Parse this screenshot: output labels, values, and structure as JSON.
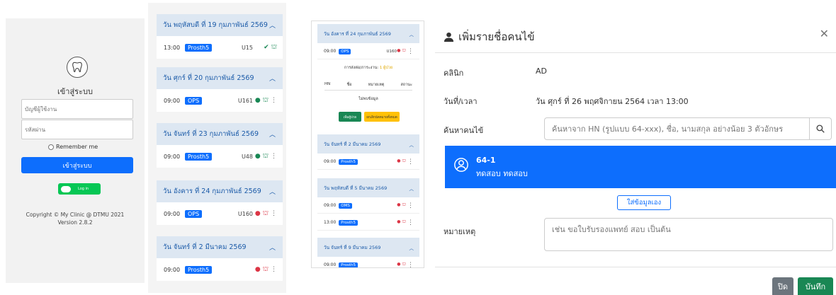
{
  "login": {
    "title": "เข้าสู่ระบบ",
    "username_placeholder": "บัญชีผู้ใช้งาน",
    "password_placeholder": "รหัสผ่าน",
    "remember_label": "Remember me",
    "login_button": "เข้าสู่ระบบ",
    "line_button": "Log in",
    "copyright": "Copyright © My Clinic @ DTMU 2021",
    "version": "Version 2.8.2"
  },
  "appointments": [
    {
      "date": "วัน พฤหัสบดี ที่ 19 กุมภาพันธ์ 2569",
      "time": "13:00",
      "clinic": "Prosth5",
      "room": "U15",
      "status": "done"
    },
    {
      "date": "วัน ศุกร์ ที่ 20 กุมภาพันธ์ 2569",
      "time": "09:00",
      "clinic": "OPS",
      "room": "U161",
      "status": "green"
    },
    {
      "date": "วัน จันทร์ ที่ 23 กุมภาพันธ์ 2569",
      "time": "09:00",
      "clinic": "Prosth5",
      "room": "U48",
      "status": "green"
    },
    {
      "date": "วัน อังคาร ที่ 24 กุมภาพันธ์ 2569",
      "time": "09:00",
      "clinic": "OPS",
      "room": "U160",
      "status": "red"
    },
    {
      "date": "วัน จันทร์ ที่ 2 มีนาคม 2569",
      "time": "09:00",
      "clinic": "Prosth5",
      "room": "",
      "status": "red"
    }
  ],
  "mini": {
    "header1": "วัน อังคาร ที่ 24 กุมภาพันธ์ 2569",
    "row1": {
      "time": "09:00",
      "clinic": "OPS",
      "room": "U160"
    },
    "referral_label": "การส่งต่อ/ภาระงาน:",
    "referral_value": "1 ผู้ป่วย",
    "cols": [
      "HN",
      "ชื่อ",
      "หมายเหตุ",
      "สถานะ"
    ],
    "no_data": "ไม่พบข้อมูล",
    "btn_add": "เพิ่มผู้ป่วย",
    "btn_cancel": "ยกเลิกนัดหมายทั้งหมด",
    "header2": "วัน จันทร์ ที่ 2 มีนาคม 2569",
    "row2": {
      "time": "09:00",
      "clinic": "Prosth5"
    },
    "header3": "วัน พฤหัสบดี ที่ 5 มีนาคม 2569",
    "row3a": {
      "time": "09:00",
      "clinic": "OMS"
    },
    "row3b": {
      "time": "13:00",
      "clinic": "Prosth5"
    },
    "header4": "วัน จันทร์ ที่ 9 มีนาคม 2569",
    "row4": {
      "time": "09:00",
      "clinic": "Prosth5"
    }
  },
  "modal": {
    "title": "เพิ่มรายชื่อคนไข้",
    "clinic_label": "คลินิก",
    "clinic_value": "AD",
    "datetime_label": "วันที่/เวลา",
    "datetime_value": "วัน ศุกร์ ที่ 26 พฤศจิกายน 2564 เวลา 13:00",
    "search_label": "ค้นหาคนไข้",
    "search_placeholder": "ค้นหาจาก HN (รูปแบบ 64-xxx), ชื่อ, นามสกุล อย่างน้อย 3 ตัวอักษร",
    "patient_id": "64-1",
    "patient_name": "ทดสอบ ทดสอบ",
    "manual_button": "ใส่ข้อมูลเอง",
    "note_label": "หมายเหตุ",
    "note_placeholder": "เช่น ขอใบรับรองแพทย์ สอบ เป็นต้น",
    "close_button": "ปิด",
    "save_button": "บันทึก"
  },
  "colors": {
    "primary": "#0d6efd",
    "success": "#198754",
    "danger": "#dc3545",
    "secondary": "#6c757d",
    "header": "#dde7f2"
  }
}
